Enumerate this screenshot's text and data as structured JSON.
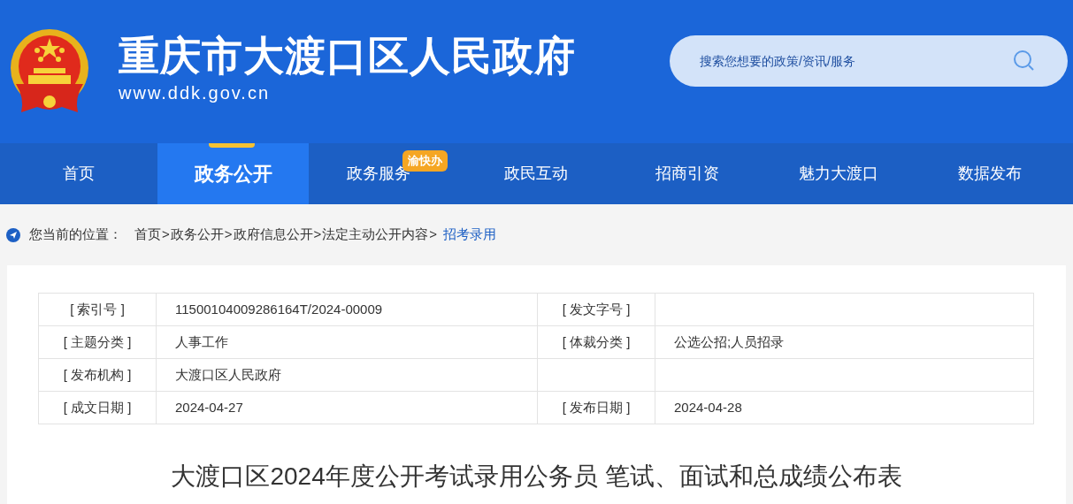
{
  "header": {
    "title": "重庆市大渡口区人民政府",
    "url": "www.ddk.gov.cn"
  },
  "search": {
    "placeholder": "搜索您想要的政策/资讯/服务"
  },
  "nav": [
    {
      "label": "首页",
      "selected": false
    },
    {
      "label": "政务公开",
      "selected": true
    },
    {
      "label": "政务服务",
      "selected": false,
      "badge": "渝快办"
    },
    {
      "label": "政民互动",
      "selected": false
    },
    {
      "label": "招商引资",
      "selected": false
    },
    {
      "label": "魅力大渡口",
      "selected": false
    },
    {
      "label": "数据发布",
      "selected": false
    }
  ],
  "breadcrumb": {
    "label": "您当前的位置：",
    "path": [
      {
        "kind": "link",
        "text": "首页"
      },
      {
        "kind": "sep",
        "text": ">"
      },
      {
        "kind": "link",
        "text": "政务公开"
      },
      {
        "kind": "sep",
        "text": ">"
      },
      {
        "kind": "link",
        "text": "政府信息公开"
      },
      {
        "kind": "sep",
        "text": ">"
      },
      {
        "kind": "link",
        "text": "法定主动公开内容"
      },
      {
        "kind": "sep",
        "text": ">"
      },
      {
        "kind": "current",
        "text": "招考录用"
      }
    ]
  },
  "table": {
    "rows": [
      {
        "cells": [
          {
            "kind": "label",
            "text": "[ 索引号 ]"
          },
          {
            "kind": "value",
            "text": "11500104009286164T/2024-00009"
          },
          {
            "kind": "label",
            "text": "[ 发文字号 ]"
          },
          {
            "kind": "value"
          }
        ]
      },
      {
        "cells": [
          {
            "kind": "label",
            "text": "[ 主题分类 ]"
          },
          {
            "kind": "value",
            "text": "人事工作"
          },
          {
            "kind": "label",
            "text": "[ 体裁分类 ]"
          },
          {
            "kind": "value",
            "text": "公选公招;人员招录"
          }
        ]
      },
      {
        "cells": [
          {
            "kind": "label",
            "text": "[ 发布机构 ]"
          },
          {
            "kind": "value",
            "text": "大渡口区人民政府"
          },
          {
            "kind": "label"
          },
          {
            "kind": "value"
          }
        ]
      },
      {
        "cells": [
          {
            "kind": "label",
            "text": "[ 成文日期 ]"
          },
          {
            "kind": "value",
            "text": "2024-04-27"
          },
          {
            "kind": "label",
            "text": "[ 发布日期 ]"
          },
          {
            "kind": "value",
            "text": "2024-04-28"
          }
        ]
      }
    ]
  },
  "article": {
    "title": "大渡口区2024年度公开考试录用公务员 笔试、面试和总成绩公布表"
  }
}
